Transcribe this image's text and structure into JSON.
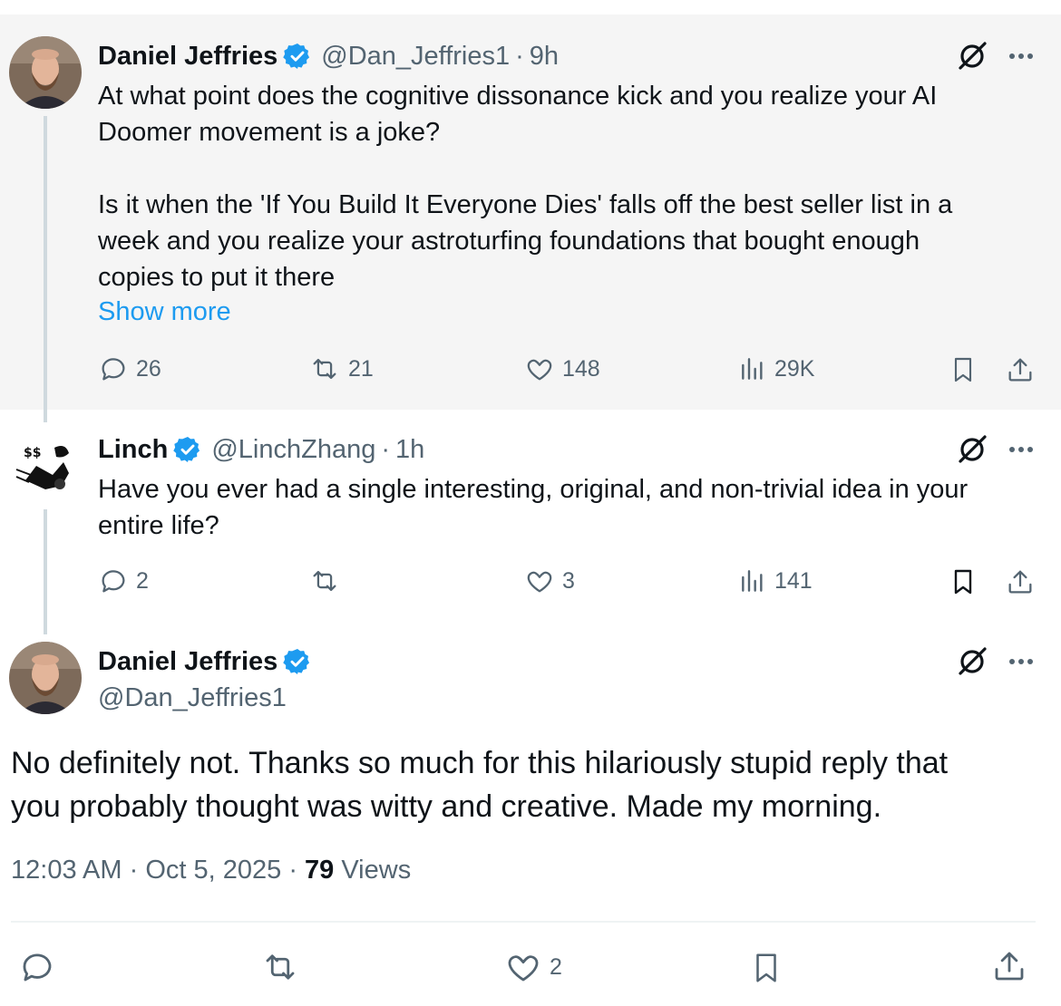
{
  "tweet1": {
    "name": "Daniel Jeffries",
    "handle": "@Dan_Jeffries1",
    "time": "9h",
    "text_line1": "At what point does the cognitive dissonance kick and you realize your AI",
    "text_line2": "Doomer movement is a joke?",
    "text_line3": "Is it when the 'If You Build It Everyone Dies' falls off the best seller list in a",
    "text_line4": "week and you realize your astroturfing foundations that bought enough",
    "text_line5": "copies to put it there",
    "show_more": "Show more",
    "replies": "26",
    "reposts": "21",
    "likes": "148",
    "views": "29K"
  },
  "tweet2": {
    "name": "Linch",
    "handle": "@LinchZhang",
    "time": "1h",
    "text_line1": "Have you ever had a single interesting, original, and non-trivial idea in your",
    "text_line2": "entire life?",
    "replies": "2",
    "likes": "3",
    "views": "141"
  },
  "main_tweet": {
    "name": "Daniel Jeffries",
    "handle": "@Dan_Jeffries1",
    "text_line1": "No definitely not. Thanks so much for this hilariously stupid reply that",
    "text_line2": "you probably thought was witty and creative. Made my morning.",
    "timestamp": "12:03 AM",
    "date": "Oct 5, 2025",
    "views_count": "79",
    "views_label": "Views",
    "likes": "2"
  },
  "colors": {
    "accent": "#1d9bf0",
    "muted": "#536471",
    "text": "#0f1419",
    "thread_bg": "#f5f5f5"
  },
  "icons": [
    "verified-badge-icon",
    "grok-icon",
    "more-icon",
    "reply-icon",
    "repost-icon",
    "like-icon",
    "views-icon",
    "bookmark-icon",
    "share-icon"
  ]
}
